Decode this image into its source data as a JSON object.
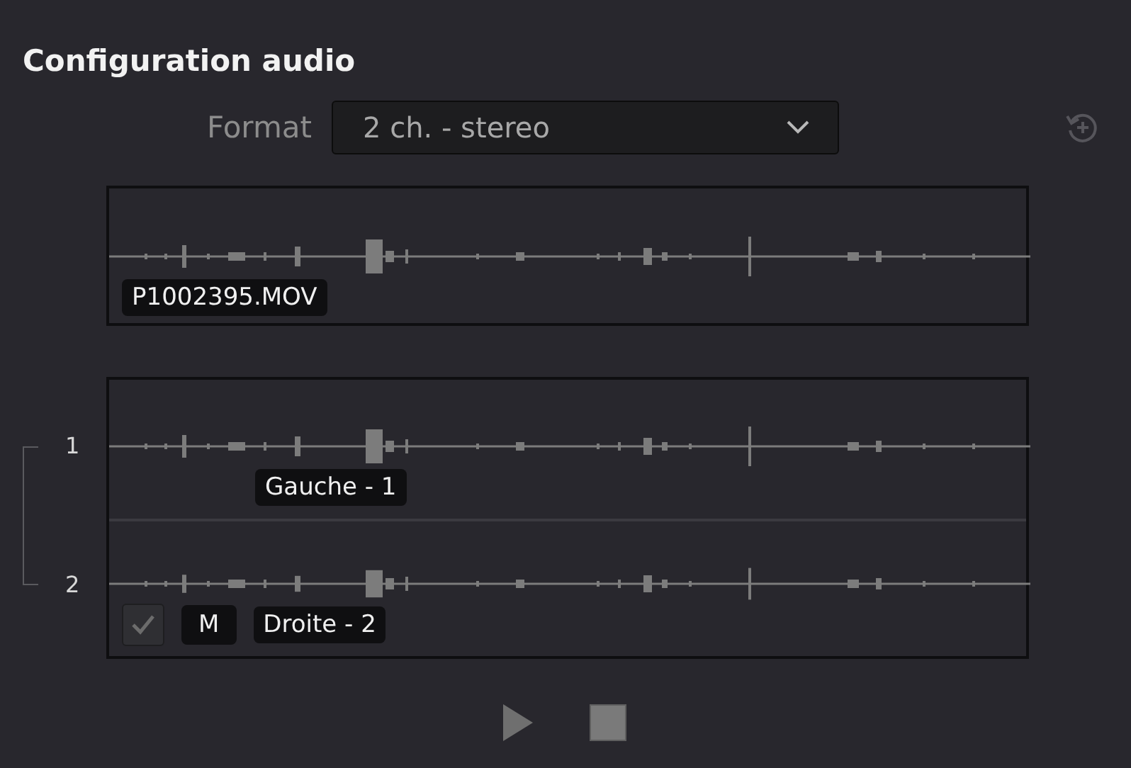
{
  "title": "Configuration audio",
  "format": {
    "label": "Format",
    "value": "2 ch. - stereo"
  },
  "source": {
    "label": "P1002395.MOV"
  },
  "channels": [
    {
      "number": "1",
      "label": "Gauche - 1"
    },
    {
      "number": "2",
      "label": "Droite - 2",
      "checkbox": {
        "checked": true
      },
      "mute": "M"
    }
  ]
}
